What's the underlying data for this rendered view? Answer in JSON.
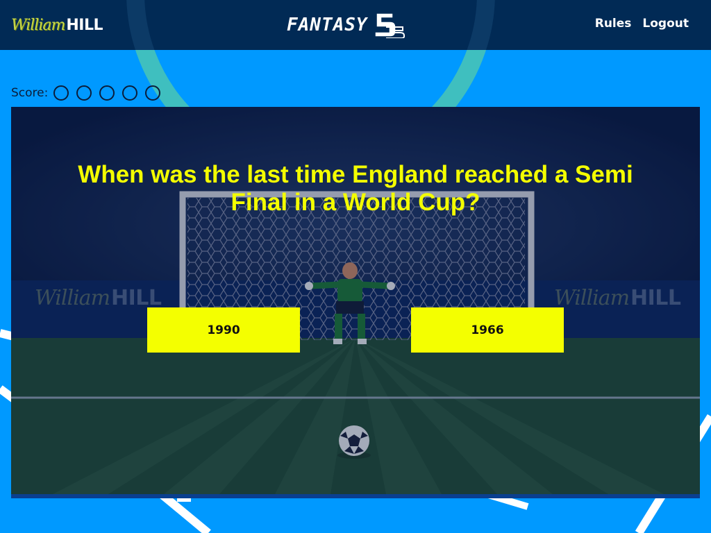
{
  "header": {
    "logo_script": "William",
    "logo_bold": "HILL",
    "brand_word": "FANTASY",
    "brand_number": "5",
    "nav": {
      "rules": "Rules",
      "logout": "Logout"
    }
  },
  "score": {
    "label": "Score:",
    "slots_total": 5,
    "slots_filled": 0
  },
  "game": {
    "question": "When was the last time England reached a Semi Final in a World Cup?",
    "answers": [
      "1990",
      "1966"
    ],
    "board_ads": [
      {
        "script": "William",
        "bold": "HILL"
      },
      {
        "script": "William",
        "bold": "HILL"
      }
    ]
  },
  "colors": {
    "page_background": "#0099ff",
    "header_background": "#012a55",
    "accent_yellow": "#f4ff00",
    "logo_green": "#c6d74a",
    "arc_teal": "#3fbfbf"
  },
  "icons": [
    "football-icon",
    "goalkeeper-figure",
    "goal-net",
    "score-slot-icon"
  ]
}
